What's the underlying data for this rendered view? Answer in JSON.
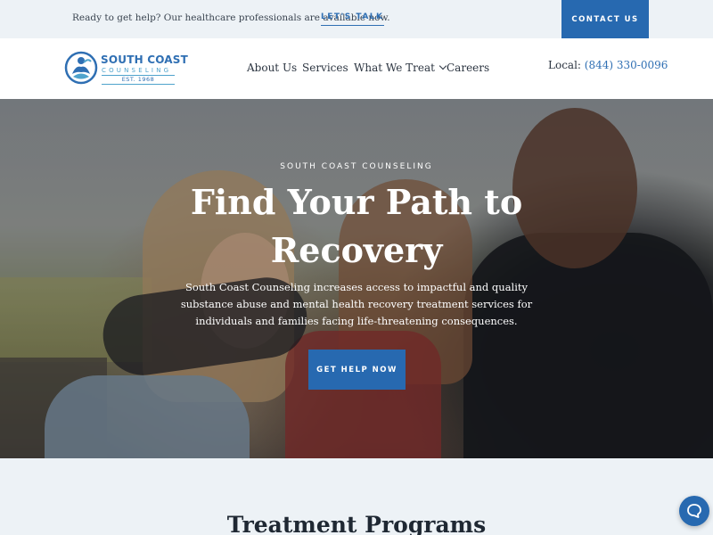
{
  "topbar": {
    "text": "Ready to get help? Our healthcare professionals are available now.",
    "link_label": "LET'S TALK",
    "contact_label": "CONTACT US"
  },
  "header": {
    "logo": {
      "name": "SOUTH COAST",
      "sub": "COUNSELING",
      "est": "EST. 1968"
    },
    "nav": [
      {
        "label": "About Us"
      },
      {
        "label": "Services"
      },
      {
        "label": "What We Treat",
        "has_dropdown": true
      },
      {
        "label": "Careers"
      }
    ],
    "local_label": "Local:",
    "phone": "(844) 330-0096"
  },
  "hero": {
    "eyebrow": "SOUTH COAST COUNSELING",
    "title": "Find Your Path to Recovery",
    "description": "South Coast Counseling increases access to impactful and quality substance abuse and mental health recovery treatment services for individuals and families facing life-threatening consequences.",
    "button_label": "GET HELP NOW"
  },
  "programs": {
    "title": "Treatment Programs"
  },
  "chat": {
    "icon": "chat-bubble-icon"
  },
  "colors": {
    "accent": "#2769b0",
    "link": "#2f6fb3",
    "topbar_bg": "#edf2f6",
    "text": "#2b3440"
  }
}
